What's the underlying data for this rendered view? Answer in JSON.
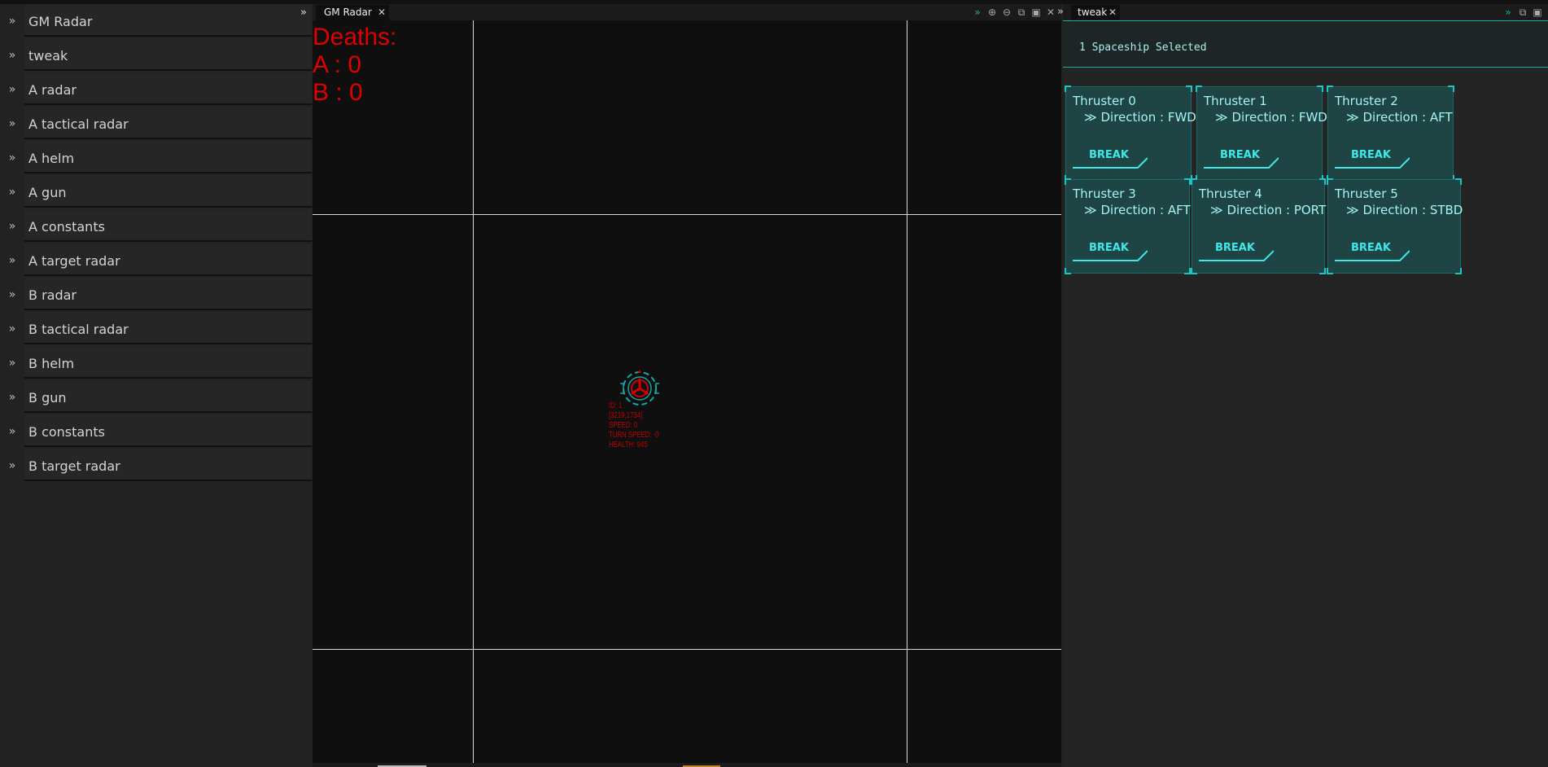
{
  "sidebar": {
    "collapse_icon": "chevron-double-right-icon",
    "items": [
      {
        "label": "GM Radar"
      },
      {
        "label": "tweak"
      },
      {
        "label": "A radar"
      },
      {
        "label": "A tactical radar"
      },
      {
        "label": "A helm"
      },
      {
        "label": "A gun"
      },
      {
        "label": "A constants"
      },
      {
        "label": "A target radar"
      },
      {
        "label": "B radar"
      },
      {
        "label": "B tactical radar"
      },
      {
        "label": "B helm"
      },
      {
        "label": "B gun"
      },
      {
        "label": "B constants"
      },
      {
        "label": "B target radar"
      }
    ]
  },
  "radar": {
    "tab_label": "GM Radar",
    "deaths": {
      "title": "Deaths:",
      "a": "A : 0",
      "b": "B : 0"
    },
    "ship": {
      "id_line": "ID: 1",
      "position": "[3219,1734]",
      "speed": "SPEED: 0",
      "turn_speed": "TURN SPEED: -0",
      "health": "HEALTH: 945"
    }
  },
  "tweak": {
    "tab_label": "tweak",
    "selected_text": "1 Spaceship Selected",
    "break_label": "BREAK",
    "thrusters": [
      {
        "title": "Thruster 0",
        "direction": "≫ Direction : FWD"
      },
      {
        "title": "Thruster 1",
        "direction": "≫ Direction : FWD"
      },
      {
        "title": "Thruster 2",
        "direction": "≫ Direction : AFT"
      },
      {
        "title": "Thruster 3",
        "direction": "≫ Direction : AFT"
      },
      {
        "title": "Thruster 4",
        "direction": "≫ Direction : PORT"
      },
      {
        "title": "Thruster 5",
        "direction": "≫ Direction : STBD"
      }
    ]
  },
  "colors": {
    "accent_cyan": "#14b0b0",
    "deaths_red": "#e10000",
    "card_bg": "#1e4444"
  }
}
